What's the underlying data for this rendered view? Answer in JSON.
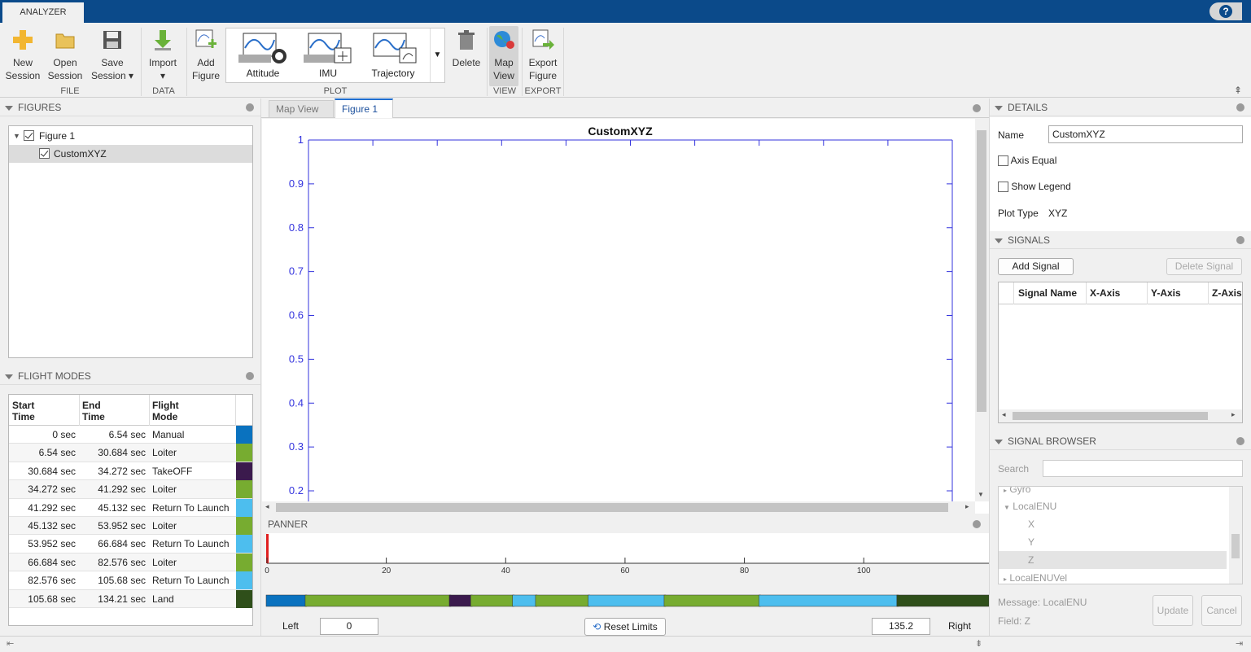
{
  "app": {
    "tab": "ANALYZER",
    "help": "?"
  },
  "toolstrip": {
    "new_session": [
      "New",
      "Session"
    ],
    "open_session": [
      "Open",
      "Session"
    ],
    "save_session": [
      "Save",
      "Session"
    ],
    "import": "Import",
    "add_figure": [
      "Add",
      "Figure"
    ],
    "attitude": "Attitude",
    "imu": "IMU",
    "trajectory": "Trajectory",
    "delete": "Delete",
    "map_view": [
      "Map",
      "View"
    ],
    "export_figure": [
      "Export",
      "Figure"
    ],
    "groups": {
      "file": "FILE",
      "data": "DATA",
      "plot": "PLOT",
      "view": "VIEW",
      "export": "EXPORT"
    }
  },
  "figures_panel": {
    "title": "FIGURES",
    "tree": [
      {
        "label": "Figure 1",
        "checked": true
      },
      {
        "label": "CustomXYZ",
        "checked": true
      }
    ]
  },
  "flight_modes": {
    "title": "FLIGHT MODES",
    "headers": [
      [
        "Start",
        "Time"
      ],
      [
        "End",
        "Time"
      ],
      [
        "Flight",
        "Mode"
      ]
    ],
    "rows": [
      {
        "start": "0 sec",
        "end": "6.54 sec",
        "mode": "Manual",
        "color": "#0a72bf"
      },
      {
        "start": "6.54 sec",
        "end": "30.684 sec",
        "mode": "Loiter",
        "color": "#77ac30"
      },
      {
        "start": "30.684 sec",
        "end": "34.272 sec",
        "mode": "TakeOFF",
        "color": "#3b1a4d"
      },
      {
        "start": "34.272 sec",
        "end": "41.292 sec",
        "mode": "Loiter",
        "color": "#77ac30"
      },
      {
        "start": "41.292 sec",
        "end": "45.132 sec",
        "mode": "Return To Launch",
        "color": "#4dbeee"
      },
      {
        "start": "45.132 sec",
        "end": "53.952 sec",
        "mode": "Loiter",
        "color": "#77ac30"
      },
      {
        "start": "53.952 sec",
        "end": "66.684 sec",
        "mode": "Return To Launch",
        "color": "#4dbeee"
      },
      {
        "start": "66.684 sec",
        "end": "82.576 sec",
        "mode": "Loiter",
        "color": "#77ac30"
      },
      {
        "start": "82.576 sec",
        "end": "105.68 sec",
        "mode": "Return To Launch",
        "color": "#4dbeee"
      },
      {
        "start": "105.68 sec",
        "end": "134.21 sec",
        "mode": "Land",
        "color": "#2f4f1a"
      }
    ]
  },
  "doc_tabs": [
    "Map View",
    "Figure 1"
  ],
  "chart_data": {
    "type": "line",
    "title": "CustomXYZ",
    "ylim": [
      0.2,
      1
    ],
    "yticks": [
      "1",
      "0.9",
      "0.8",
      "0.7",
      "0.6",
      "0.5",
      "0.4",
      "0.3",
      "0.2"
    ],
    "series": []
  },
  "panner": {
    "title": "PANNER",
    "ticks": [
      "0",
      "20",
      "40",
      "60",
      "80",
      "100"
    ],
    "xlim": [
      0,
      135.2
    ],
    "left_label": "Left",
    "left_value": "0",
    "reset": "Reset Limits",
    "right_value": "135.2",
    "right_label": "Right"
  },
  "details": {
    "title": "DETAILS",
    "name_label": "Name",
    "name_value": "CustomXYZ",
    "axis_equal": "Axis Equal",
    "show_legend": "Show Legend",
    "plot_type_label": "Plot Type",
    "plot_type_value": "XYZ"
  },
  "signals": {
    "title": "SIGNALS",
    "add": "Add Signal",
    "delete": "Delete Signal",
    "columns": [
      "Signal Name",
      "X-Axis",
      "Y-Axis",
      "Z-Axis"
    ]
  },
  "signal_browser": {
    "title": "SIGNAL BROWSER",
    "search_label": "Search",
    "tree": [
      "Gyro",
      "LocalENU",
      "X",
      "Y",
      "Z",
      "LocalENUVel"
    ],
    "message": "Message: LocalENU",
    "field": "Field: Z",
    "update": "Update",
    "cancel": "Cancel"
  }
}
